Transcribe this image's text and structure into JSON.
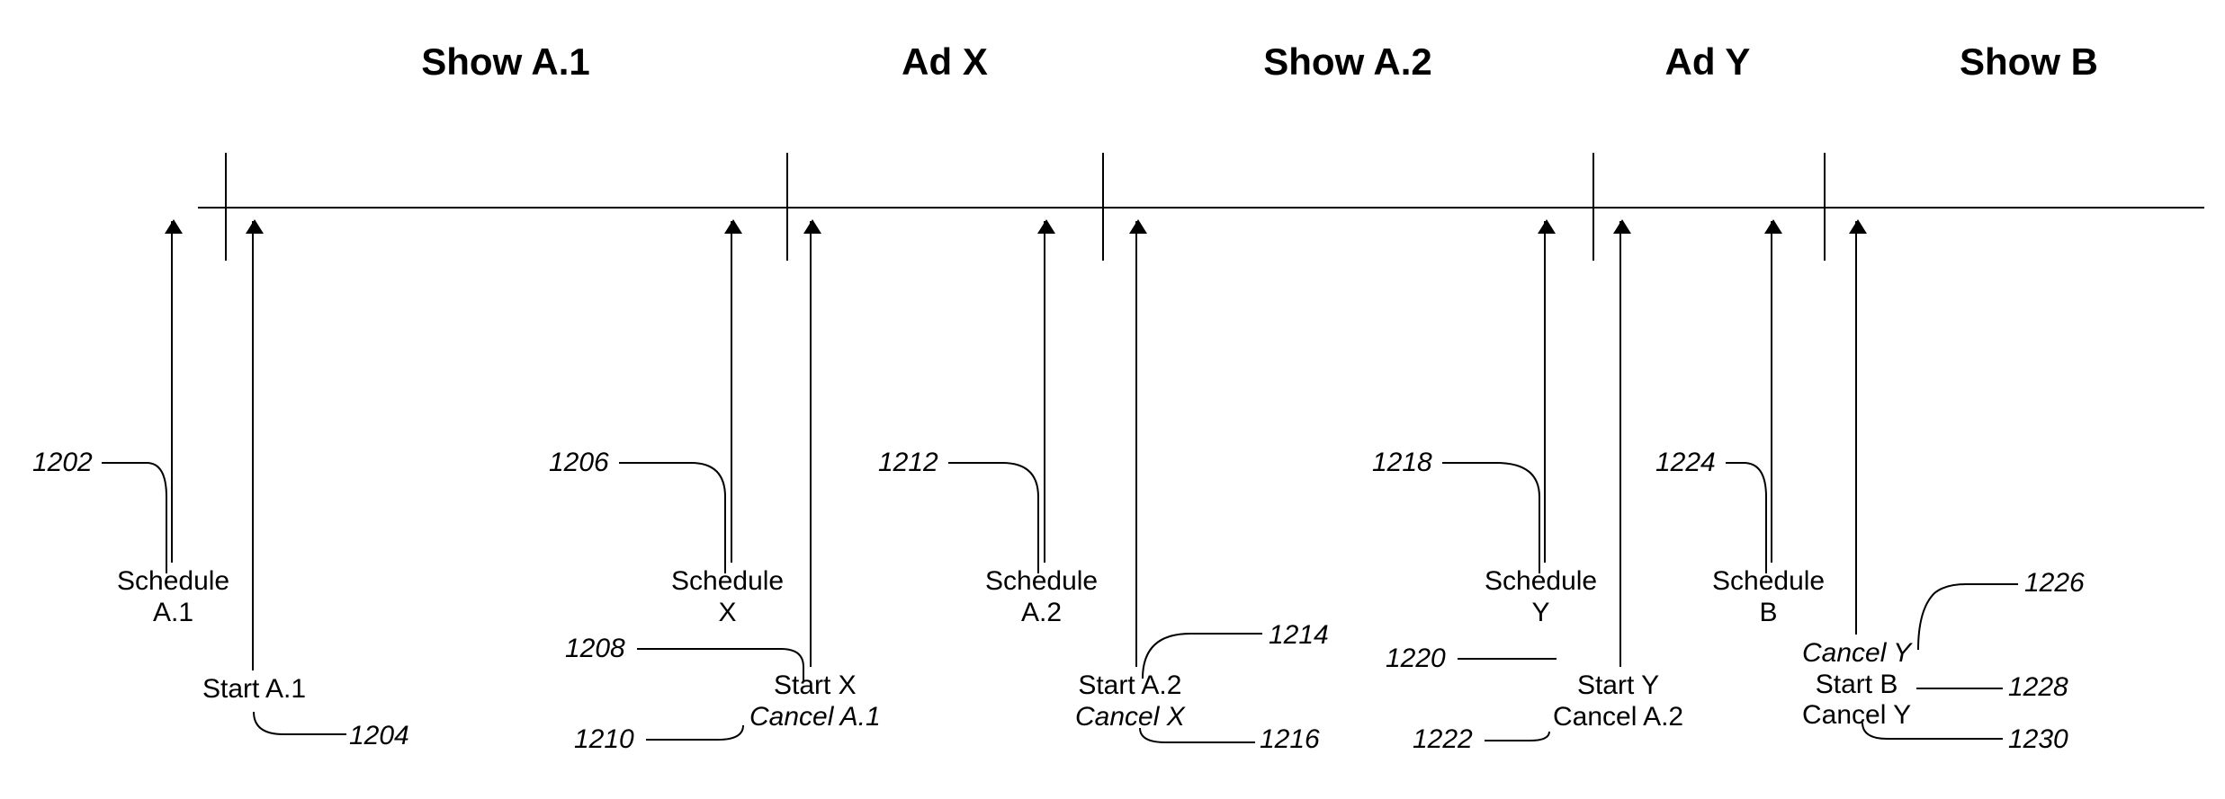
{
  "segments": {
    "show_a1": "Show A.1",
    "ad_x": "Ad X",
    "show_a2": "Show A.2",
    "ad_y": "Ad Y",
    "show_b": "Show B"
  },
  "events": {
    "schedule_a1": "Schedule\nA.1",
    "start_a1": "Start A.1",
    "schedule_x": "Schedule\nX",
    "start_x_l1": "Start X",
    "start_x_l2": "Cancel A.1",
    "schedule_a2": "Schedule\nA.2",
    "start_a2_l1": "Start A.2",
    "start_a2_l2": "Cancel X",
    "schedule_y": "Schedule\nY",
    "start_y_l1": "Start Y",
    "start_y_l2": "Cancel A.2",
    "schedule_b": "Schedule\nB",
    "start_b_l1": "Cancel Y",
    "start_b_l2": "Start B",
    "start_b_l3": "Cancel Y"
  },
  "refs": {
    "r1202": "1202",
    "r1204": "1204",
    "r1206": "1206",
    "r1208": "1208",
    "r1210": "1210",
    "r1212": "1212",
    "r1214": "1214",
    "r1216": "1216",
    "r1218": "1218",
    "r1220": "1220",
    "r1222": "1222",
    "r1224": "1224",
    "r1226": "1226",
    "r1228": "1228",
    "r1230": "1230"
  }
}
